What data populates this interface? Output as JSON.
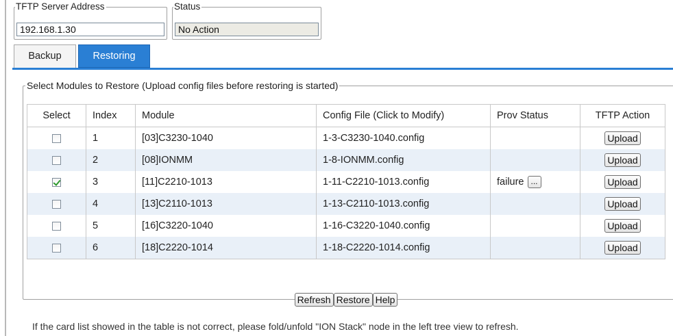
{
  "tftp_server": {
    "legend": "TFTP Server Address",
    "value": "192.168.1.30"
  },
  "status": {
    "legend": "Status",
    "value": "No Action"
  },
  "tabs": [
    {
      "label": "Backup",
      "active": false
    },
    {
      "label": "Restoring",
      "active": true
    }
  ],
  "modules": {
    "legend": "Select Modules to Restore (Upload config files before restoring is started)",
    "columns": [
      "Select",
      "Index",
      "Module",
      "Config File (Click to Modify)",
      "Prov Status",
      "TFTP Action"
    ],
    "rows": [
      {
        "checked": false,
        "index": "1",
        "module": "[03]C3230-1040",
        "config": "1-3-C3230-1040.config",
        "prov_status": "",
        "action": "Upload"
      },
      {
        "checked": false,
        "index": "2",
        "module": "[08]IONMM",
        "config": "1-8-IONMM.config",
        "prov_status": "",
        "action": "Upload"
      },
      {
        "checked": true,
        "index": "3",
        "module": "[11]C2210-1013",
        "config": "1-11-C2210-1013.config",
        "prov_status": "failure",
        "prov_button": "...",
        "action": "Upload"
      },
      {
        "checked": false,
        "index": "4",
        "module": "[13]C2110-1013",
        "config": "1-13-C2110-1013.config",
        "prov_status": "",
        "action": "Upload"
      },
      {
        "checked": false,
        "index": "5",
        "module": "[16]C3220-1040",
        "config": "1-16-C3220-1040.config",
        "prov_status": "",
        "action": "Upload"
      },
      {
        "checked": false,
        "index": "6",
        "module": "[18]C2220-1014",
        "config": "1-18-C2220-1014.config",
        "prov_status": "",
        "action": "Upload"
      }
    ]
  },
  "buttons": {
    "refresh": "Refresh",
    "restore": "Restore",
    "help": "Help"
  },
  "footer_note": "If the card list showed in the table is not correct, please fold/unfold \"ION Stack\" node in the left tree view to refresh.",
  "colors": {
    "tab_active": "#2a7fd4",
    "row_alt": "#e9f0f8",
    "status_bg": "#ecebe4"
  }
}
